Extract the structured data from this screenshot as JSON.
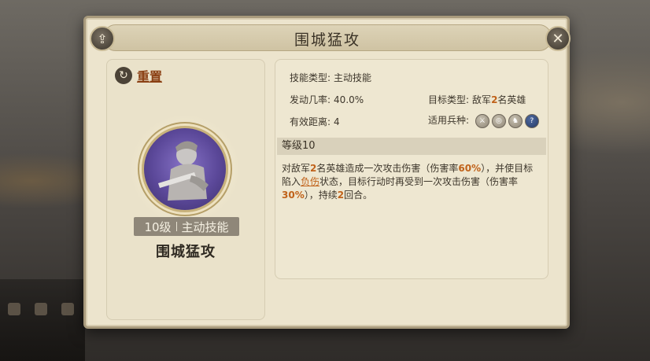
{
  "dialog": {
    "title": "围城猛攻",
    "share_icon": "share-icon",
    "close_icon": "close-icon"
  },
  "left": {
    "reset_label": "重置",
    "reset_icon": "reset-icon",
    "level_text": "10级",
    "skill_kind": "主动技能",
    "skill_name": "围城猛攻"
  },
  "info": {
    "type_label": "技能类型:",
    "type_value": "主动技能",
    "rate_label": "发动几率:",
    "rate_value": "40.0%",
    "target_label": "目标类型:",
    "target_prefix": "敌军",
    "target_count": "2",
    "target_suffix": "名英雄",
    "range_label": "有效距离:",
    "range_value": "4",
    "troops_label": "适用兵种:",
    "troop_icons": [
      "sword-icon",
      "bow-icon",
      "horse-icon",
      "question-icon"
    ]
  },
  "detail": {
    "level_header": "等级10",
    "d1": "对敌军",
    "d2": "2",
    "d3": "名英雄造成一次攻击伤害（伤害率",
    "d4": "60%",
    "d5": "），并使目标陷入",
    "d6": "负伤",
    "d7": "状态，目标行动时再受到一次攻击伤害（伤害率",
    "d8": "30%",
    "d9": "），持续",
    "d10": "2",
    "d11": "回合。"
  },
  "colors": {
    "highlight": "#c0621a",
    "panel": "#ece4cd",
    "emblem": "#5b4899"
  }
}
